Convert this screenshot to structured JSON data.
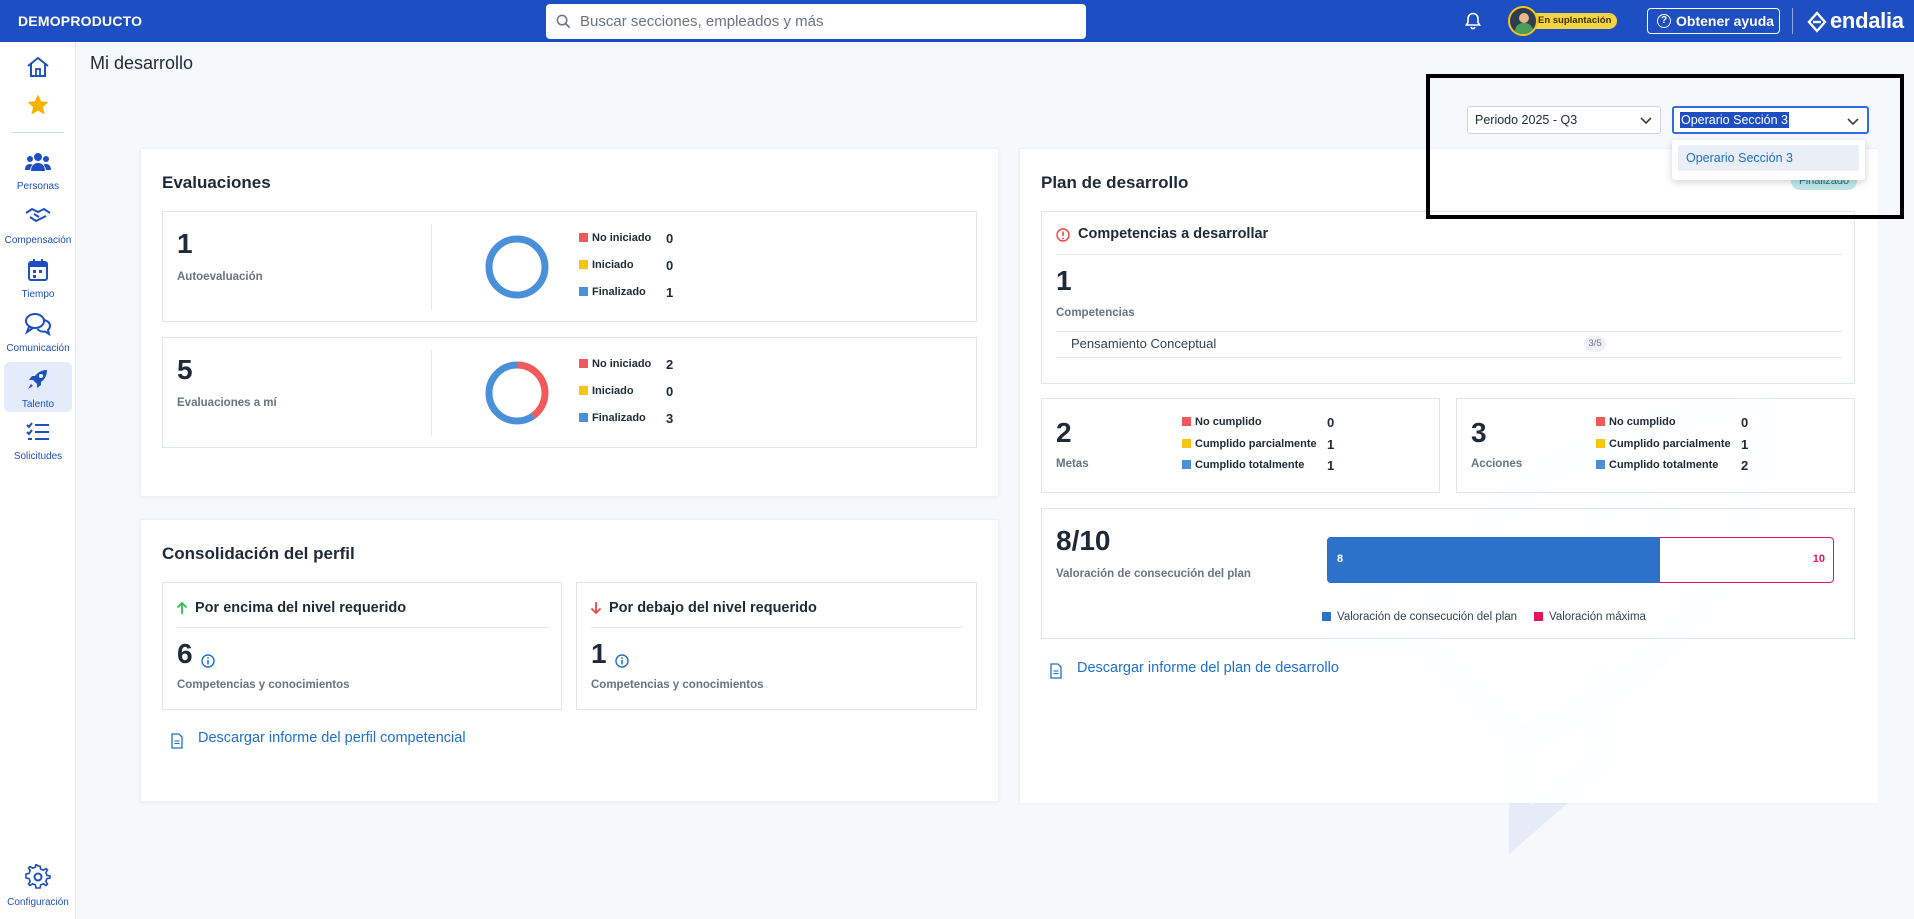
{
  "topbar": {
    "brand": "DEMOPRODUCTO",
    "search_placeholder": "Buscar secciones, empleados y más",
    "impersonation_badge": "En suplantación",
    "help_label": "Obtener ayuda",
    "logo_text": "endalia"
  },
  "sidebar": {
    "items": [
      {
        "icon": "home-icon",
        "label": ""
      },
      {
        "icon": "star-icon",
        "label": ""
      },
      {
        "icon": "people-icon",
        "label": "Personas"
      },
      {
        "icon": "handshake-icon",
        "label": "Compensación"
      },
      {
        "icon": "calendar-icon",
        "label": "Tiempo"
      },
      {
        "icon": "chat-icon",
        "label": "Comunicación"
      },
      {
        "icon": "rocket-icon",
        "label": "Talento"
      },
      {
        "icon": "checklist-icon",
        "label": "Solicitudes"
      },
      {
        "icon": "gear-icon",
        "label": "Configuración"
      }
    ],
    "active": "Talento"
  },
  "page": {
    "title": "Mi desarrollo"
  },
  "filters": {
    "period": "Periodo 2025 - Q3",
    "position": "Operario Sección 3",
    "position_options": [
      "Operario Sección 3"
    ]
  },
  "evaluaciones": {
    "title": "Evaluaciones",
    "legend_labels": [
      "No iniciado",
      "Iniciado",
      "Finalizado"
    ],
    "colors": {
      "no_iniciado": "#f05a5a",
      "iniciado": "#f6c413",
      "finalizado": "#4a90d9"
    },
    "items": [
      {
        "count": "1",
        "label": "Autoevaluación",
        "no_iniciado": 0,
        "iniciado": 0,
        "finalizado": 1
      },
      {
        "count": "5",
        "label": "Evaluaciones a mí",
        "no_iniciado": 2,
        "iniciado": 0,
        "finalizado": 3
      }
    ]
  },
  "consolidacion": {
    "title": "Consolidación del perfil",
    "above": {
      "heading": "Por encima del nivel requerido",
      "count": "6",
      "label": "Competencias y conocimientos"
    },
    "below": {
      "heading": "Por debajo del nivel requerido",
      "count": "1",
      "label": "Competencias y conocimientos"
    },
    "download_link": "Descargar informe del perfil competencial"
  },
  "plan": {
    "title": "Plan de desarrollo",
    "status": "Finalizado",
    "competencias": {
      "heading": "Competencias a desarrollar",
      "count": "1",
      "label": "Competencias",
      "items": [
        {
          "name": "Pensamiento Conceptual",
          "score": "3/5"
        }
      ]
    },
    "legend_labels": [
      "No cumplido",
      "Cumplido parcialmente",
      "Cumplido totalmente"
    ],
    "metas": {
      "count": "2",
      "label": "Metas",
      "values": [
        "0",
        "1",
        "1"
      ]
    },
    "acciones": {
      "count": "3",
      "label": "Acciones",
      "values": [
        "0",
        "1",
        "2"
      ]
    },
    "valoracion": {
      "score": "8/10",
      "label": "Valoración de consecución del plan",
      "value": 8,
      "max": 10,
      "value_label": "8",
      "max_label": "10",
      "legend": [
        "Valoración de consecución del plan",
        "Valoración máxima"
      ],
      "colors": {
        "value": "#2d72c9",
        "max": "#e2175e"
      }
    },
    "download_link": "Descargar informe del plan de desarrollo"
  }
}
